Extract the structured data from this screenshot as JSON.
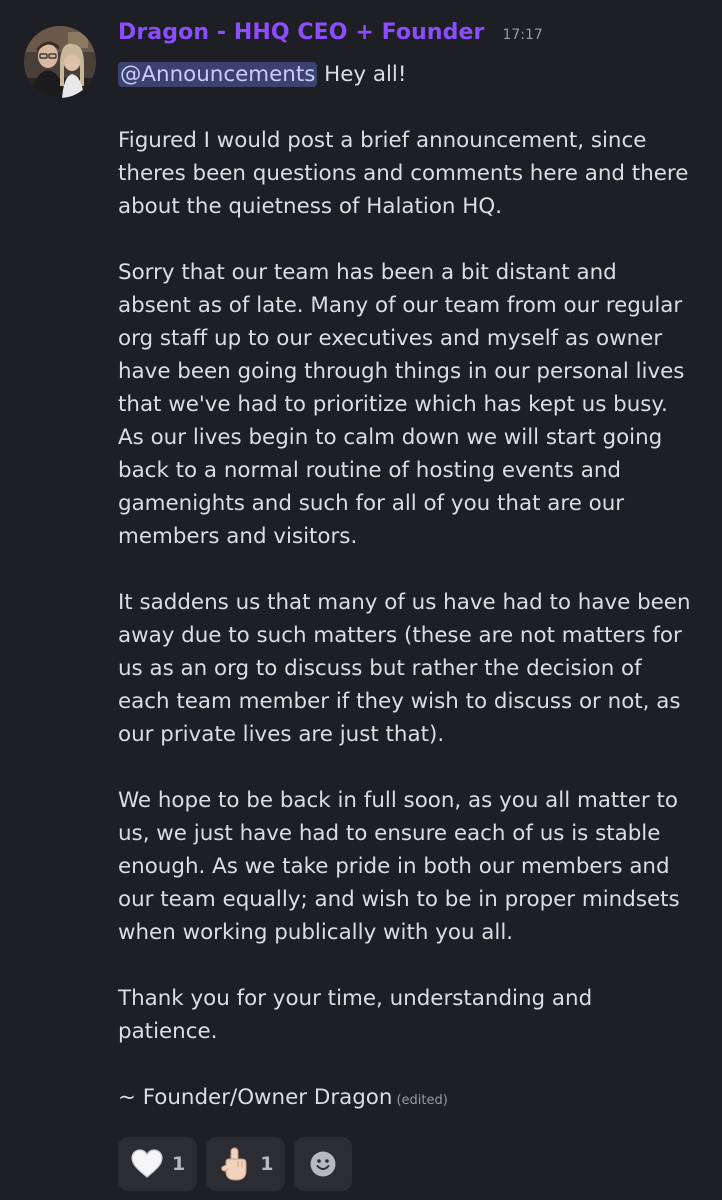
{
  "message": {
    "author": "Dragon - HHQ CEO + Founder",
    "timestamp": "17:17",
    "mention": "@Announcements",
    "lines": [
      " Hey all!",
      "",
      "Figured I would post a brief announcement, since",
      "theres been questions and comments here and there",
      "about the quietness of Halation HQ.",
      "",
      "Sorry that our team has been a bit distant and",
      "absent as of late. Many of our team from our regular",
      "org staff up to our executives and myself as owner",
      "have been going through things in our personal lives",
      "that we've had to prioritize which has kept us busy.",
      "As our lives begin to calm down we will start going",
      "back to a normal routine of hosting events and",
      "gamenights and such for all of you that are our",
      "members and visitors.",
      "",
      "It saddens us that many of us have had to have been",
      "away due to such matters (these are not matters for",
      "us as an org to discuss but rather the decision of",
      "each team member if they wish to discuss or not, as",
      "our private lives are just that).",
      "",
      "We hope to be back in full soon, as you all matter to",
      "us, we just have had to ensure each of us is stable",
      "enough. As we take pride in both our members and",
      "our team equally; and wish to be in proper mindsets",
      "when working publically with you all.",
      "",
      "Thank you for your time, understanding and",
      "patience.",
      "",
      "~ Founder/Owner Dragon"
    ],
    "edited_label": "(edited)"
  },
  "reactions": [
    {
      "emoji": "white-heart-icon",
      "count": "1"
    },
    {
      "emoji": "pointing-up-hand-icon",
      "count": "1"
    }
  ],
  "add_reaction_icon": "smiley-add-reaction-icon",
  "colors": {
    "background": "#1e1f24",
    "username": "#8b4dff",
    "mention_bg": "#3c4270",
    "reaction_bg": "#2b2d33"
  }
}
